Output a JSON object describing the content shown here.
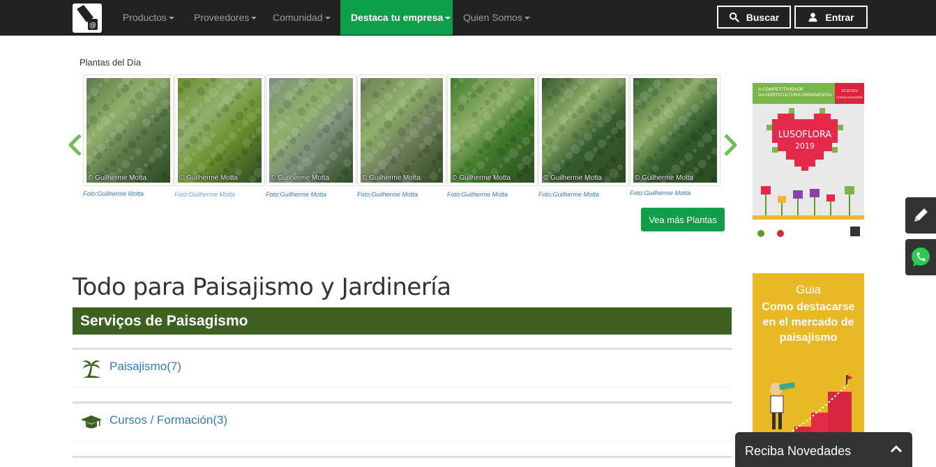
{
  "navbar": {
    "menu": [
      {
        "label": "Productos"
      },
      {
        "label": "Proveedores"
      },
      {
        "label": "Comunidad"
      },
      {
        "label": "Destaca tu empresa"
      },
      {
        "label": "Quien Somos"
      }
    ],
    "search_label": "Buscar",
    "login_label": "Entrar"
  },
  "plants": {
    "title": "Plantas del Día",
    "watermark": "© Guilherme Motta",
    "credit": "Foto:Guilherme Motta",
    "more_button": "Vea más Plantas",
    "items": [
      {
        "color": "#5b7a4a"
      },
      {
        "color": "#6b8f2e"
      },
      {
        "color": "#7d8f7a"
      },
      {
        "color": "#6d7d5a"
      },
      {
        "color": "#3f7a2a"
      },
      {
        "color": "#355c2e"
      },
      {
        "color": "#2f5a2a"
      }
    ]
  },
  "ads": {
    "lusoflora": {
      "header": "A COMPETITIVIDADE DA HORTICULTURA ORNAMENTAL",
      "dates": "22-23 FEV",
      "place": "CNEMA SANTARÉM",
      "name": "LUSOFLORA",
      "year": "2019"
    },
    "guide": {
      "line1": "Guia",
      "line2": "Como destacarse en el mercado de paisajismo"
    }
  },
  "main": {
    "title": "Todo para Paisajismo y Jardinería",
    "section": "Serviços de Paisagismo",
    "categories": [
      {
        "label": "Paisajismo(7)",
        "icon": "palm-tree-icon"
      },
      {
        "label": "Cursos / Formación(3)",
        "icon": "graduation-cap-icon"
      }
    ]
  },
  "newsletter": {
    "label": "Reciba Novedades"
  },
  "colors": {
    "navbar": "#222222",
    "accent_green": "#0e9f4b",
    "section_green": "#3c6121",
    "link_blue": "#337ab7"
  }
}
